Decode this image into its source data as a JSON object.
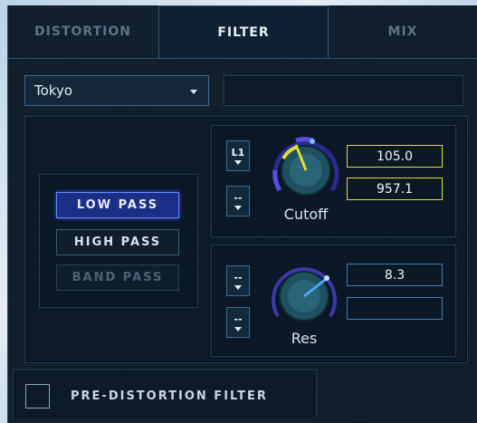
{
  "tabs": [
    {
      "label": "DISTORTION",
      "active": false
    },
    {
      "label": "FILTER",
      "active": true
    },
    {
      "label": "MIX",
      "active": false
    }
  ],
  "preset": {
    "selected": "Tokyo"
  },
  "filter_types": [
    {
      "label": "LOW PASS",
      "state": "selected"
    },
    {
      "label": "HIGH PASS",
      "state": "normal"
    },
    {
      "label": "BAND PASS",
      "state": "disabled"
    }
  ],
  "cutoff": {
    "label": "Cutoff",
    "mod_source_1": "L1",
    "mod_source_2": "--",
    "value_1": "105.0",
    "value_2": "957.1",
    "accent": "#e2dd35"
  },
  "resonance": {
    "label": "Res",
    "mod_source_1": "--",
    "mod_source_2": "--",
    "value_1": "8.3",
    "value_2": "",
    "accent": "#3f7fb8"
  },
  "pre_distortion": {
    "label": "PRE-DISTORTION FILTER",
    "checked": false
  },
  "colors": {
    "panel_bg": "#0c1a28",
    "active_button": "#1c2f86",
    "knob_arc": "#5a4de0",
    "knob_indicator_cutoff": "#e2dd35",
    "knob_indicator_res": "#4aa8ff"
  }
}
